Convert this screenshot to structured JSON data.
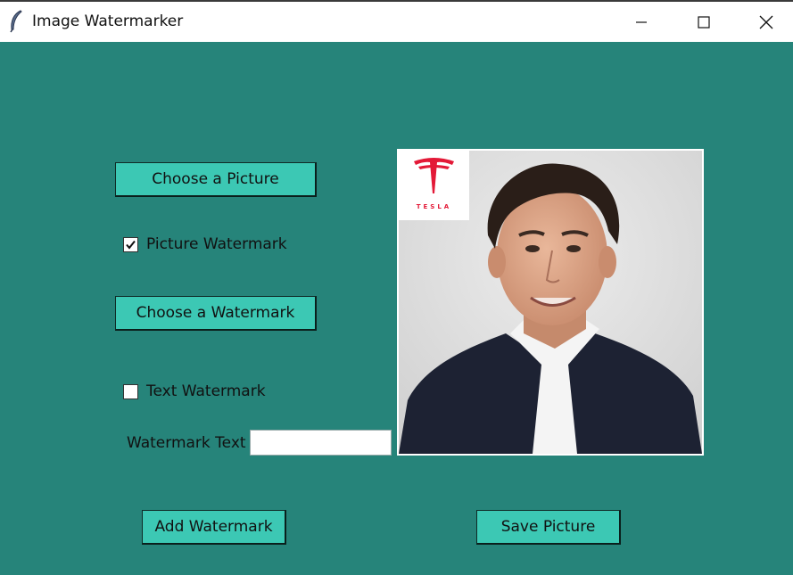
{
  "window": {
    "title": "Image Watermarker"
  },
  "controls": {
    "choose_picture_label": "Choose a Picture",
    "picture_watermark_label": "Picture Watermark",
    "picture_watermark_checked": true,
    "choose_watermark_label": "Choose a Watermark",
    "text_watermark_label": "Text Watermark",
    "text_watermark_checked": false,
    "watermark_text_label": "Watermark Text",
    "watermark_text_value": "",
    "add_watermark_label": "Add Watermark",
    "save_picture_label": "Save Picture"
  },
  "preview": {
    "watermark_logo_text": "TESLA"
  },
  "colors": {
    "background": "#26847a",
    "button": "#3cc8b4",
    "logo_red": "#e31937"
  }
}
